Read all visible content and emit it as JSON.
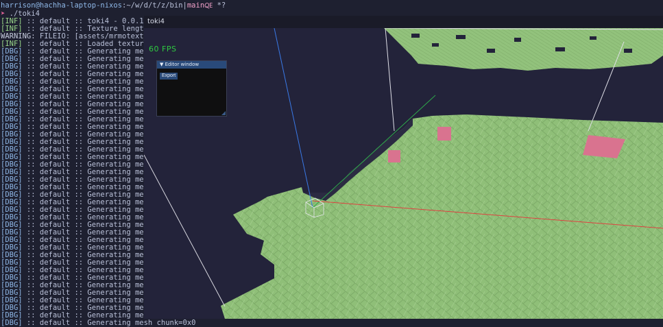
{
  "terminal": {
    "prompt": {
      "user_host": "harrison@hachha-laptop-nixos",
      "path": ":~/w/d/t/z/bin",
      "separator": "|",
      "branch": "main",
      "branch_icon": "🜀",
      "dirty": " *?"
    },
    "command": {
      "arrow": "➤",
      "text": " ./toki4"
    },
    "lines": [
      {
        "tag": "[INF]",
        "kind": "inf",
        "text": " :: default :: toki4 - 0.0.1"
      },
      {
        "tag": "[INF]",
        "kind": "inf",
        "text": " :: default :: Texture length is"
      },
      {
        "tag": "WARNING:",
        "kind": "warn",
        "text": " FILEIO: [assets/mrmotext_ex"
      },
      {
        "tag": "[INF]",
        "kind": "inf",
        "text": " :: default :: Loaded textures"
      },
      {
        "tag": "[DBG]",
        "kind": "dbg",
        "text": " :: default :: Generating mesh"
      },
      {
        "tag": "[DBG]",
        "kind": "dbg",
        "text": " :: default :: Generating mesh"
      },
      {
        "tag": "[DBG]",
        "kind": "dbg",
        "text": " :: default :: Generating mesh"
      },
      {
        "tag": "[DBG]",
        "kind": "dbg",
        "text": " :: default :: Generating mesh"
      },
      {
        "tag": "[DBG]",
        "kind": "dbg",
        "text": " :: default :: Generating mesh"
      },
      {
        "tag": "[DBG]",
        "kind": "dbg",
        "text": " :: default :: Generating mesh"
      },
      {
        "tag": "[DBG]",
        "kind": "dbg",
        "text": " :: default :: Generating mesh"
      },
      {
        "tag": "[DBG]",
        "kind": "dbg",
        "text": " :: default :: Generating mesh"
      },
      {
        "tag": "[DBG]",
        "kind": "dbg",
        "text": " :: default :: Generating mesh"
      },
      {
        "tag": "[DBG]",
        "kind": "dbg",
        "text": " :: default :: Generating mesh"
      },
      {
        "tag": "[DBG]",
        "kind": "dbg",
        "text": " :: default :: Generating mesh"
      },
      {
        "tag": "[DBG]",
        "kind": "dbg",
        "text": " :: default :: Generating mesh"
      },
      {
        "tag": "[DBG]",
        "kind": "dbg",
        "text": " :: default :: Generating mesh"
      },
      {
        "tag": "[DBG]",
        "kind": "dbg",
        "text": " :: default :: Generating mesh"
      },
      {
        "tag": "[DBG]",
        "kind": "dbg",
        "text": " :: default :: Generating mesh"
      },
      {
        "tag": "[DBG]",
        "kind": "dbg",
        "text": " :: default :: Generating mesh"
      },
      {
        "tag": "[DBG]",
        "kind": "dbg",
        "text": " :: default :: Generating mesh"
      },
      {
        "tag": "[DBG]",
        "kind": "dbg",
        "text": " :: default :: Generating mesh"
      },
      {
        "tag": "[DBG]",
        "kind": "dbg",
        "text": " :: default :: Generating mesh"
      },
      {
        "tag": "[DBG]",
        "kind": "dbg",
        "text": " :: default :: Generating mesh"
      },
      {
        "tag": "[DBG]",
        "kind": "dbg",
        "text": " :: default :: Generating mesh"
      },
      {
        "tag": "[DBG]",
        "kind": "dbg",
        "text": " :: default :: Generating mesh"
      },
      {
        "tag": "[DBG]",
        "kind": "dbg",
        "text": " :: default :: Generating mesh"
      },
      {
        "tag": "[DBG]",
        "kind": "dbg",
        "text": " :: default :: Generating mesh"
      },
      {
        "tag": "[DBG]",
        "kind": "dbg",
        "text": " :: default :: Generating mesh"
      },
      {
        "tag": "[DBG]",
        "kind": "dbg",
        "text": " :: default :: Generating mesh"
      },
      {
        "tag": "[DBG]",
        "kind": "dbg",
        "text": " :: default :: Generating mesh"
      },
      {
        "tag": "[DBG]",
        "kind": "dbg",
        "text": " :: default :: Generating mesh"
      },
      {
        "tag": "[DBG]",
        "kind": "dbg",
        "text": " :: default :: Generating mesh"
      },
      {
        "tag": "[DBG]",
        "kind": "dbg",
        "text": " :: default :: Generating mesh"
      },
      {
        "tag": "[DBG]",
        "kind": "dbg",
        "text": " :: default :: Generating mesh"
      },
      {
        "tag": "[DBG]",
        "kind": "dbg",
        "text": " :: default :: Generating mesh"
      },
      {
        "tag": "[DBG]",
        "kind": "dbg",
        "text": " :: default :: Generating mesh"
      },
      {
        "tag": "[DBG]",
        "kind": "dbg",
        "text": " :: default :: Generating mesh"
      },
      {
        "tag": "[DBG]",
        "kind": "dbg",
        "text": " :: default :: Generating mesh"
      },
      {
        "tag": "[DBG]",
        "kind": "dbg",
        "text": " :: default :: Generating mesh"
      },
      {
        "tag": "[DBG]",
        "kind": "dbg",
        "text": " :: default :: Generating mesh chunk=0x0"
      }
    ]
  },
  "game_window": {
    "title": "toki4",
    "fps": "60 FPS",
    "editor": {
      "title": "Editor window",
      "collapse_glyph": "▼",
      "export_label": "Export"
    }
  },
  "colors": {
    "terminal_bg": "#1e2030",
    "ground_green": "#8fbf78",
    "cube_pink": "#d9738f",
    "axis_x": "#e04040",
    "axis_y": "#3a7ae8",
    "axis_z": "#2ea84a",
    "fps_green": "#2ecc40"
  }
}
